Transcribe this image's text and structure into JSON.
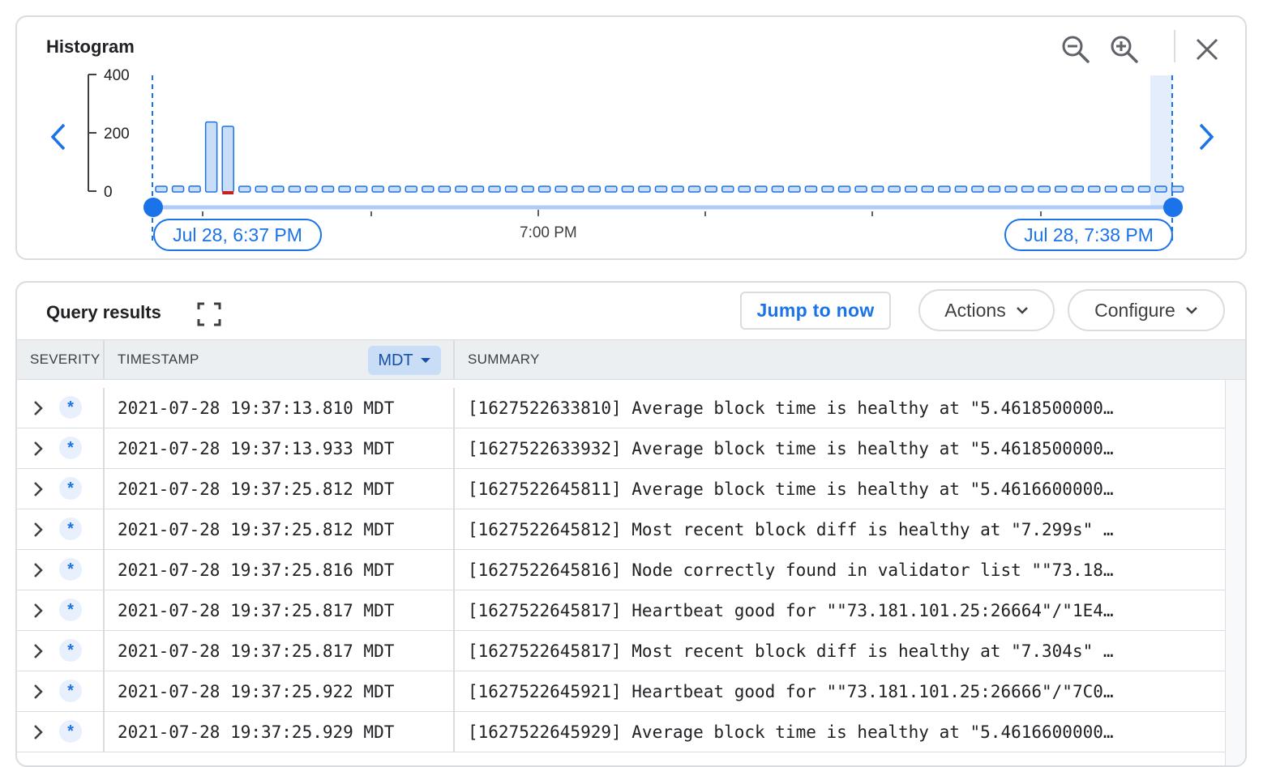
{
  "histogram": {
    "title": "Histogram",
    "y_ticks": [
      "400",
      "200",
      "0"
    ],
    "start_label": "Jul 28, 6:37 PM",
    "end_label": "Jul 28, 7:38 PM",
    "center_tick_label": "7:00 PM",
    "icons": {
      "zoom_out": "zoom-out-icon",
      "zoom_in": "zoom-in-icon",
      "close": "close-icon",
      "prev": "chevron-left-icon",
      "next": "chevron-right-icon"
    },
    "chart_data": {
      "type": "bar",
      "ylim": [
        0,
        400
      ],
      "values": [
        5,
        20,
        20,
        240,
        225,
        0,
        0,
        0,
        0,
        0,
        0,
        0,
        0,
        0,
        0,
        0,
        0,
        0,
        0,
        0,
        0,
        0,
        0,
        0,
        0,
        0,
        0,
        0,
        0,
        0,
        0,
        0,
        0,
        0,
        0,
        0,
        0,
        0,
        0,
        0,
        0,
        0,
        0,
        0,
        0,
        0,
        0,
        0,
        0,
        0,
        0,
        0,
        0,
        0,
        0,
        0,
        0,
        0,
        0,
        0,
        0,
        5
      ],
      "error_bar_index": 4,
      "colors": {
        "bar_fill": "#c9ddf7",
        "bar_stroke": "#1a73e8",
        "error": "#c5221f"
      }
    }
  },
  "results": {
    "title": "Query results",
    "expand_icon": "fullscreen-icon",
    "jump_label": "Jump to now",
    "actions_label": "Actions",
    "configure_label": "Configure",
    "columns": {
      "severity": "SEVERITY",
      "timestamp": "TIMESTAMP",
      "timezone": "MDT",
      "summary": "SUMMARY"
    },
    "rows": [
      {
        "ts": "2021-07-28 19:37:13.810 MDT",
        "summary": "[1627522633810] Average block time is healthy at \"5.4618500000…"
      },
      {
        "ts": "2021-07-28 19:37:13.933 MDT",
        "summary": "[1627522633932] Average block time is healthy at \"5.4618500000…"
      },
      {
        "ts": "2021-07-28 19:37:25.812 MDT",
        "summary": "[1627522645811] Average block time is healthy at \"5.4616600000…"
      },
      {
        "ts": "2021-07-28 19:37:25.812 MDT",
        "summary": "[1627522645812] Most recent block diff is healthy at \"7.299s\"  …"
      },
      {
        "ts": "2021-07-28 19:37:25.816 MDT",
        "summary": "[1627522645816] Node correctly found in validator list \"\"73.18…"
      },
      {
        "ts": "2021-07-28 19:37:25.817 MDT",
        "summary": "[1627522645817] Heartbeat good for \"\"73.181.101.25:26664\"/\"1E4…"
      },
      {
        "ts": "2021-07-28 19:37:25.817 MDT",
        "summary": "[1627522645817] Most recent block diff is healthy at \"7.304s\"  …"
      },
      {
        "ts": "2021-07-28 19:37:25.922 MDT",
        "summary": "[1627522645921] Heartbeat good for \"\"73.181.101.25:26666\"/\"7C0…"
      },
      {
        "ts": "2021-07-28 19:37:25.929 MDT",
        "summary": "[1627522645929] Average block time is healthy at \"5.4616600000…"
      }
    ],
    "severity_icon": "info-asterisk-icon",
    "expand_row_icon": "chevron-right-icon"
  }
}
